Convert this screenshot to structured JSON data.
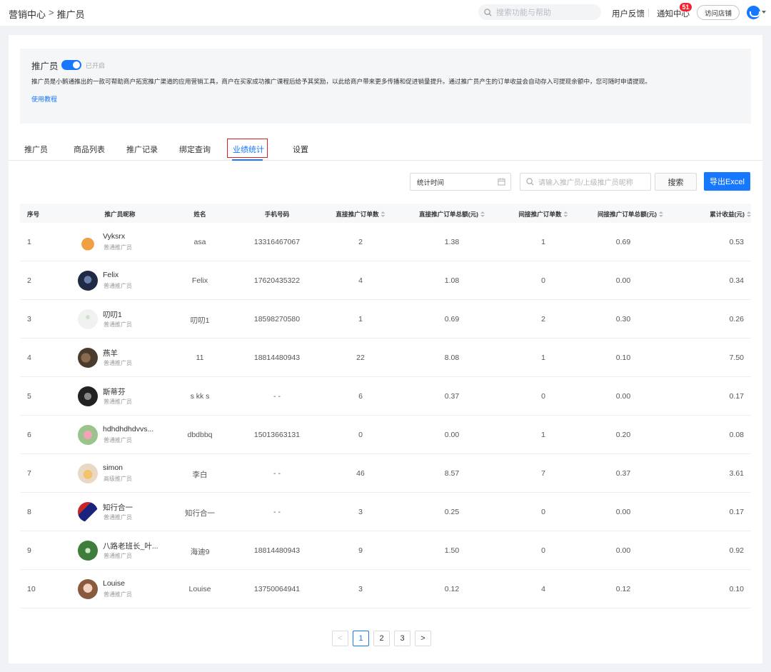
{
  "breadcrumb": {
    "root": "营销中心",
    "separator": ">",
    "current": "推广员"
  },
  "topbar": {
    "search_placeholder": "搜索功能与帮助",
    "feedback": "用户反馈",
    "notify": "通知中心",
    "notify_count": "51",
    "visit_store": "访问店铺"
  },
  "intro": {
    "title": "推广员",
    "toggle_state": "已开启",
    "description": "推广员是小鹅通推出的一款可帮助商户拓宽推广渠道的应用营销工具，商户在买家成功推广课程后给予其奖励，以此给商户带来更多传播和促进销量提升。通过推广员产生的订单收益会自动存入可提现余额中，您可随时申请提现。",
    "help_link": "使用教程"
  },
  "tabs": [
    "推广员",
    "商品列表",
    "推广记录",
    "绑定查询",
    "业绩统计",
    "设置"
  ],
  "active_tab": 4,
  "filters": {
    "date_placeholder": "统计时间",
    "search_placeholder": "请输入推广员/上级推广员昵称",
    "search_button": "搜索",
    "export_button": "导出Excel"
  },
  "table": {
    "headers": [
      "序号",
      "推广员昵称",
      "姓名",
      "手机号码",
      "直接推广订单数",
      "直接推广订单总额(元)",
      "间接推广订单数",
      "间接推广订单总额(元)",
      "累计收益(元)"
    ],
    "rows": [
      {
        "no": "1",
        "nick": "Vyksrx",
        "level": "普通推广员",
        "name": "asa",
        "phone": "13316467067",
        "direct_orders": "2",
        "direct_amount": "1.38",
        "indirect_orders": "1",
        "indirect_amount": "0.69",
        "income": "0.53",
        "avatar": "fox-avatar"
      },
      {
        "no": "2",
        "nick": "Felix",
        "level": "普通推广员",
        "name": "Felix",
        "phone": "17620435322",
        "direct_orders": "4",
        "direct_amount": "1.08",
        "indirect_orders": "0",
        "indirect_amount": "0.00",
        "income": "0.34",
        "avatar": "dark-portrait-avatar"
      },
      {
        "no": "3",
        "nick": "叨叨1",
        "level": "普通推广员",
        "name": "叨叨1",
        "phone": "18598270580",
        "direct_orders": "1",
        "direct_amount": "0.69",
        "indirect_orders": "2",
        "indirect_amount": "0.30",
        "income": "0.26",
        "avatar": "light-avatar"
      },
      {
        "no": "4",
        "nick": "燕羊",
        "level": "普通推广员",
        "name": "11",
        "phone": "18814480943",
        "direct_orders": "22",
        "direct_amount": "8.08",
        "indirect_orders": "1",
        "indirect_amount": "0.10",
        "income": "7.50",
        "avatar": "group-photo-avatar"
      },
      {
        "no": "5",
        "nick": "斯蒂芬",
        "level": "普通推广员",
        "name": "s kk s",
        "phone": "- -",
        "direct_orders": "6",
        "direct_amount": "0.37",
        "indirect_orders": "0",
        "indirect_amount": "0.00",
        "income": "0.17",
        "avatar": "bw-photo-avatar"
      },
      {
        "no": "6",
        "nick": "hdhdhdhdvvs...",
        "level": "普通推广员",
        "name": "dbdbbq",
        "phone": "15013663131",
        "direct_orders": "0",
        "direct_amount": "0.00",
        "indirect_orders": "1",
        "indirect_amount": "0.20",
        "income": "0.08",
        "avatar": "flower-avatar"
      },
      {
        "no": "7",
        "nick": "simon",
        "level": "高级推广员",
        "name": "李白",
        "phone": "- -",
        "direct_orders": "46",
        "direct_amount": "8.57",
        "indirect_orders": "7",
        "indirect_amount": "0.37",
        "income": "3.61",
        "avatar": "sunset-avatar"
      },
      {
        "no": "8",
        "nick": "知行合一",
        "level": "普通推广员",
        "name": "知行合一",
        "phone": "- -",
        "direct_orders": "3",
        "direct_amount": "0.25",
        "indirect_orders": "0",
        "indirect_amount": "0.00",
        "income": "0.17",
        "avatar": "flag-avatar"
      },
      {
        "no": "9",
        "nick": "八路老班长_叶...",
        "level": "普通推广员",
        "name": "海迪9",
        "phone": "18814480943",
        "direct_orders": "9",
        "direct_amount": "1.50",
        "indirect_orders": "0",
        "indirect_amount": "0.00",
        "income": "0.92",
        "avatar": "green-nature-avatar"
      },
      {
        "no": "10",
        "nick": "Louise",
        "level": "普通推广员",
        "name": "Louise",
        "phone": "13750064941",
        "direct_orders": "3",
        "direct_amount": "0.12",
        "indirect_orders": "4",
        "indirect_amount": "0.12",
        "income": "0.10",
        "avatar": "girl-portrait-avatar"
      }
    ]
  },
  "pagination": {
    "prev": "<",
    "pages": [
      "1",
      "2",
      "3"
    ],
    "current": "1",
    "next": ">"
  },
  "colors": {
    "primary": "#1677ff",
    "badge": "#f5222d",
    "highlight_border": "#e02020"
  }
}
